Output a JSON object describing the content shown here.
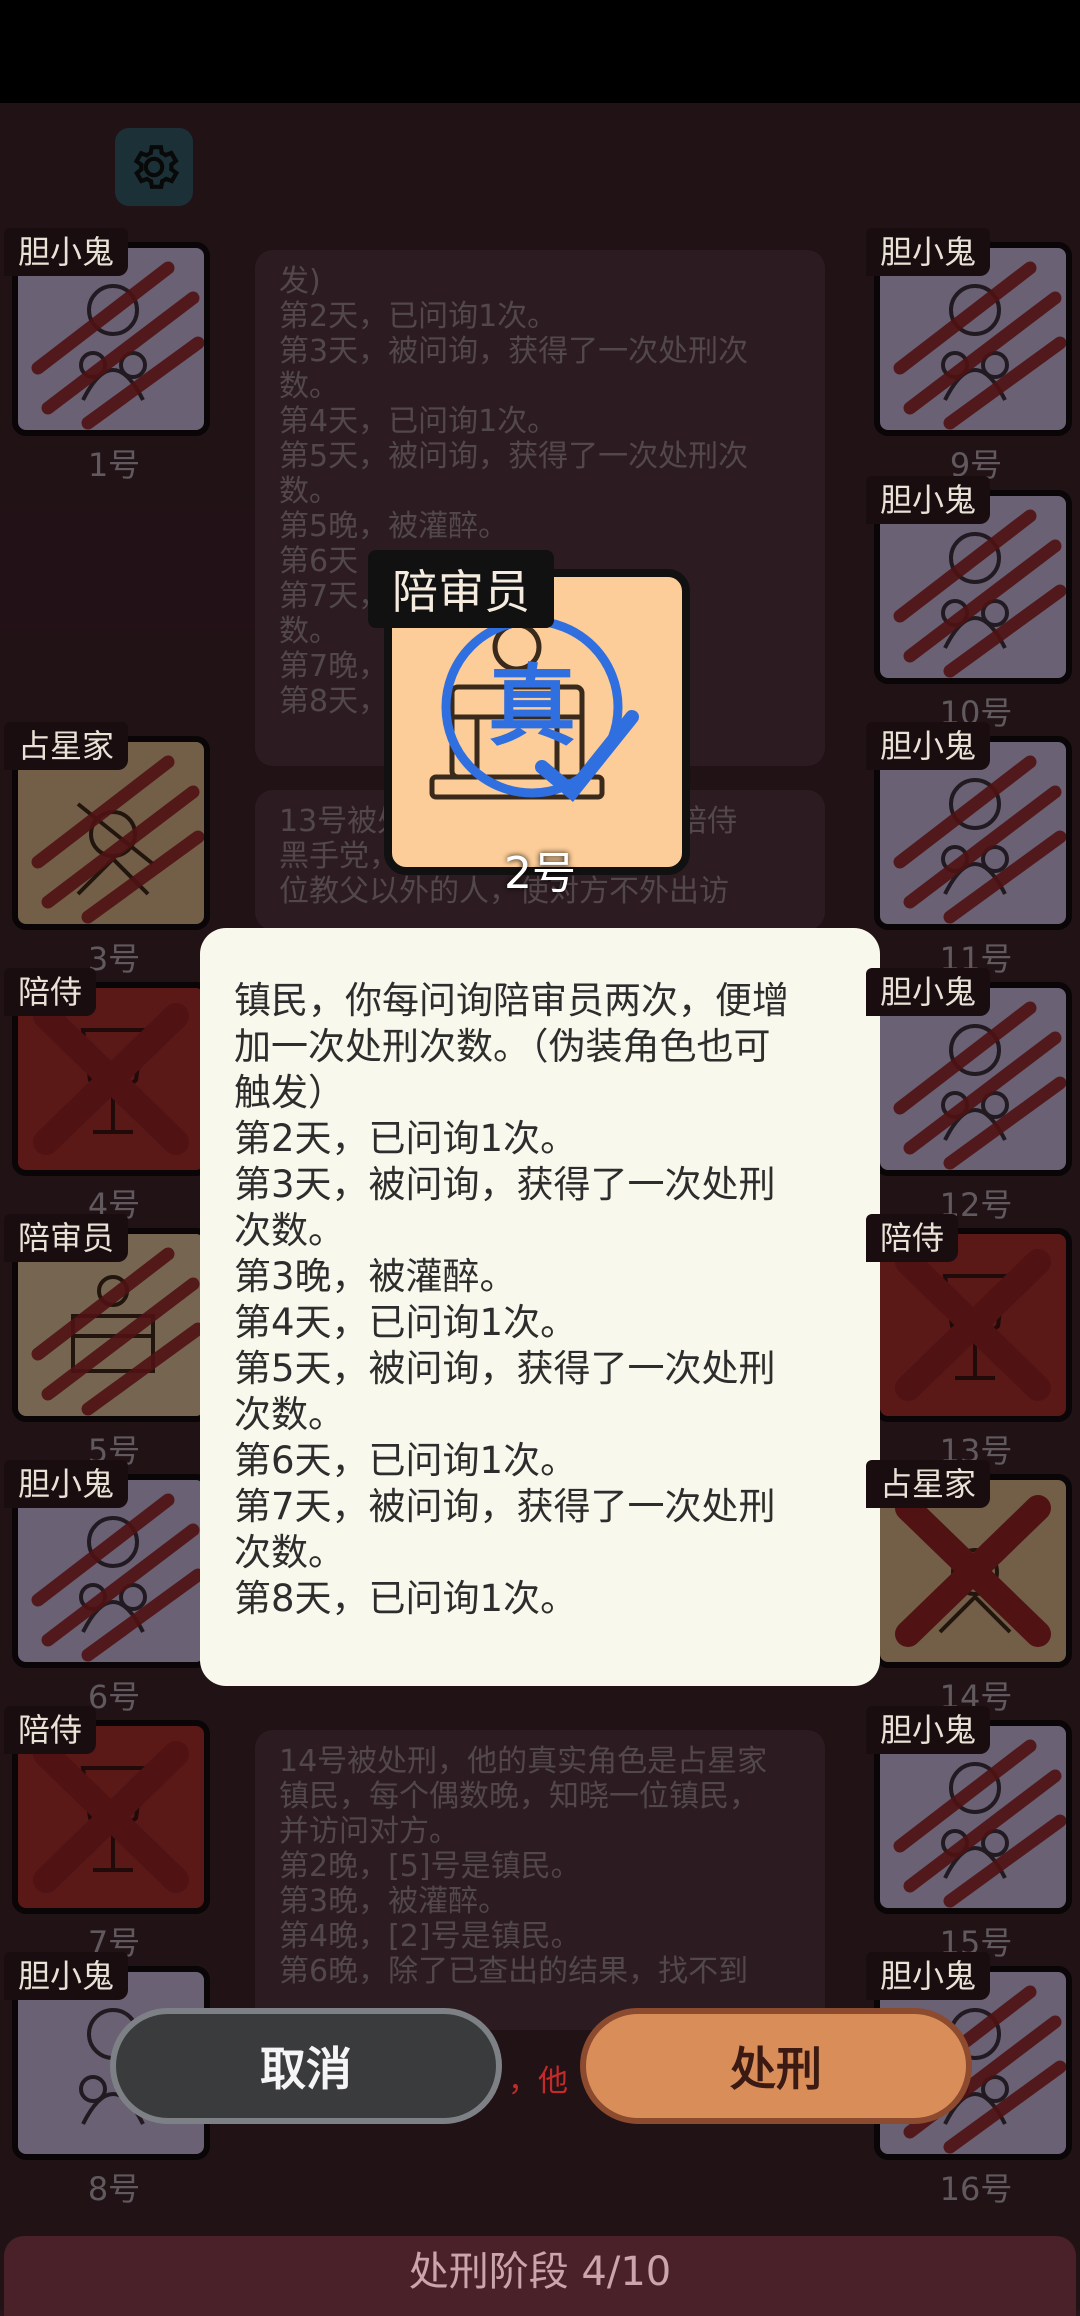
{
  "juror": {
    "role": "陪审员",
    "number": "2号",
    "stamp": "真"
  },
  "cards_left": [
    {
      "role": "胆小鬼",
      "number": "1号"
    },
    {
      "role": "占星家",
      "number": "3号"
    },
    {
      "role": "陪侍",
      "number": "4号"
    },
    {
      "role": "陪审员",
      "number": "5号"
    },
    {
      "role": "胆小鬼",
      "number": "6号"
    },
    {
      "role": "陪侍",
      "number": "7号"
    },
    {
      "role": "胆小鬼",
      "number": "8号"
    }
  ],
  "cards_right": [
    {
      "role": "胆小鬼",
      "number": "9号"
    },
    {
      "role": "胆小鬼",
      "number": "10号"
    },
    {
      "role": "胆小鬼",
      "number": "11号"
    },
    {
      "role": "胆小鬼",
      "number": "12号"
    },
    {
      "role": "陪侍",
      "number": "13号"
    },
    {
      "role": "占星家",
      "number": "14号"
    },
    {
      "role": "胆小鬼",
      "number": "15号"
    },
    {
      "role": "胆小鬼",
      "number": "16号"
    }
  ],
  "log_top": [
    "发)",
    "第2天，已问询1次。",
    "第3天，被问询，获得了一次处刑次",
    "数。",
    "第4天，已问询1次。",
    "第5天，被问询，获得了一次处刑次",
    "数。",
    "第5晚，被灌醉。",
    "第6天",
    "第7天，",
    "数。",
    "第7晚，",
    "第8天，"
  ],
  "log_mid": [
    "13号被处刑，他的真实角色是陪侍",
    "黑手党，每晚可以灌醉一",
    "位教父以外的人，使对方不外出访"
  ],
  "log_bottom": [
    "14号被处刑，他的真实角色是占星家",
    "镇民，每个偶数晚，知晓一位镇民，",
    "并访问对方。",
    "第2晚，[5]号是镇民。",
    "第3晚，被灌醉。",
    "第4晚，[2]号是镇民。",
    "第6晚，除了已查出的结果，找不到"
  ],
  "popup_lines": [
    "镇民，你每问询陪审员两次，便增",
    "加一次处刑次数。（伪装角色也可",
    "触发）",
    "第2天，已问询1次。",
    "第3天，被问询，获得了一次处刑",
    "次数。",
    "第3晚，被灌醉。",
    "第4天，已问询1次。",
    "第5天，被问询，获得了一次处刑",
    "次数。",
    "第6天，已问询1次。",
    "第7天，被问询，获得了一次处刑",
    "次数。",
    "第8天，已问询1次。"
  ],
  "buttons": {
    "cancel": "取消",
    "execute": "处刑"
  },
  "hint_partial": "，他",
  "phase": "处刑阶段 4/10",
  "icons": {
    "settings": "gear-icon"
  },
  "colors": {
    "popup_bg": "#f8f8ec",
    "execute_btn": "#d98d59",
    "cancel_btn": "#3a3b3d",
    "stamp_blue": "#2f6fe0"
  }
}
